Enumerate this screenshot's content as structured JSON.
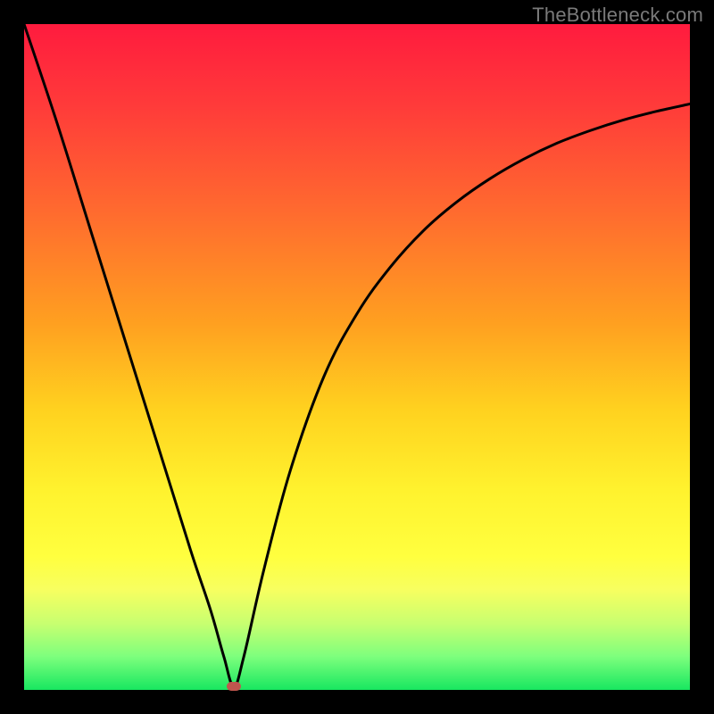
{
  "watermark": "TheBottleneck.com",
  "colors": {
    "frame": "#000000",
    "curve": "#000000",
    "marker": "#c0564e"
  },
  "chart_data": {
    "type": "line",
    "title": "",
    "xlabel": "",
    "ylabel": "",
    "xlim": [
      0,
      100
    ],
    "ylim": [
      0,
      100
    ],
    "grid": false,
    "legend": false,
    "series": [
      {
        "name": "bottleneck-curve",
        "x": [
          0,
          5,
          10,
          15,
          20,
          25,
          28,
          30,
          31.5,
          33,
          36,
          40,
          45,
          50,
          55,
          60,
          65,
          70,
          75,
          80,
          85,
          90,
          95,
          100
        ],
        "y": [
          100,
          85,
          69,
          53,
          37,
          21,
          12,
          5,
          0.5,
          5,
          18,
          33,
          47,
          56.5,
          63.5,
          69,
          73.3,
          76.8,
          79.7,
          82.1,
          84,
          85.6,
          86.9,
          88
        ]
      }
    ],
    "markers": [
      {
        "name": "trough-marker",
        "x": 31.5,
        "y": 0.5
      }
    ],
    "annotations": []
  }
}
